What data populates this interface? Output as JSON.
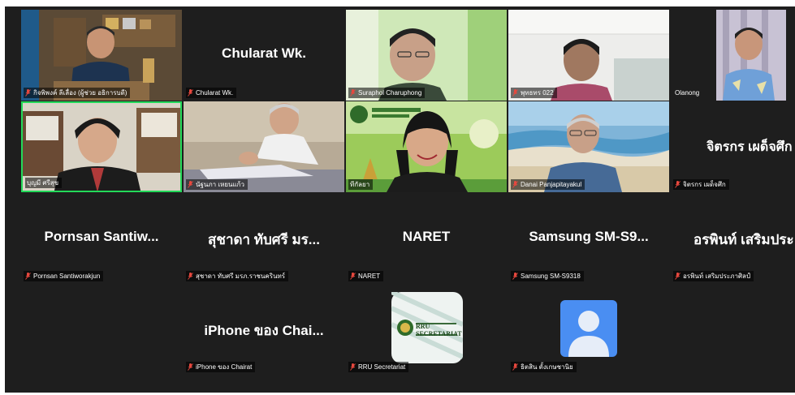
{
  "meeting": {
    "participants": [
      {
        "id": "p1",
        "name": "กิจพิพงค์ ลีเลื่อง (ผู้ช่วย อธิการบดี)",
        "big": "",
        "video": true,
        "muted": true,
        "active": false
      },
      {
        "id": "p2",
        "name": "Chularat Wk.",
        "big": "Chularat Wk.",
        "video": false,
        "muted": true,
        "active": false
      },
      {
        "id": "p3",
        "name": "Suraphol Charuphong",
        "big": "",
        "video": true,
        "muted": true,
        "active": false
      },
      {
        "id": "p4",
        "name": "พุทธทร 022",
        "big": "",
        "video": true,
        "muted": true,
        "active": false
      },
      {
        "id": "p5",
        "name": "Olanong",
        "big": "",
        "video": true,
        "muted": false,
        "active": false
      },
      {
        "id": "p6",
        "name": "บุญมี ศรีสุข",
        "big": "",
        "video": true,
        "muted": false,
        "active": true
      },
      {
        "id": "p7",
        "name": "นัฐนภา เหยนแก้ว",
        "big": "",
        "video": true,
        "muted": true,
        "active": false
      },
      {
        "id": "p8",
        "name": "ทีกัลยา",
        "big": "",
        "video": true,
        "muted": false,
        "active": false
      },
      {
        "id": "p9",
        "name": "Danai Panjapitayakul",
        "big": "",
        "video": true,
        "muted": true,
        "active": false
      },
      {
        "id": "p10",
        "name": "จิตรกร เผด็จศึก",
        "big": "จิตรกร เผด็จศึก",
        "video": false,
        "muted": true,
        "active": false
      },
      {
        "id": "p11",
        "name": "Pornsan Santiworakjun",
        "big": "Pornsan  Santiw...",
        "video": false,
        "muted": true,
        "active": false
      },
      {
        "id": "p12",
        "name": "สุชาดา ทับศรี มรภ.ราชนครินทร์",
        "big": "สุชาดา ทับศรี มร...",
        "video": false,
        "muted": true,
        "active": false
      },
      {
        "id": "p13",
        "name": "NARET",
        "big": "NARET",
        "video": false,
        "muted": true,
        "active": false
      },
      {
        "id": "p14",
        "name": "Samsung SM-S9318",
        "big": "Samsung  SM-S9...",
        "video": false,
        "muted": true,
        "active": false
      },
      {
        "id": "p15",
        "name": "อรพินท์ เสริมประภาศิลป์",
        "big": "อรพินท์ เสริมประ",
        "video": false,
        "muted": true,
        "active": false
      },
      {
        "id": "p16",
        "name": "iPhone ของ Chairat",
        "big": "iPhone ของ Chai...",
        "video": false,
        "muted": true,
        "active": false
      },
      {
        "id": "p17",
        "name": "RRU Secretariat",
        "big": "",
        "video": false,
        "muted": true,
        "active": false,
        "logo": "RRU SECRETARIAT"
      },
      {
        "id": "p18",
        "name": "ธิตสิน ตั้งเกษชานิย",
        "big": "",
        "video": false,
        "muted": true,
        "active": false,
        "avatar": "default-person-avatar"
      }
    ]
  },
  "colors": {
    "background": "#1e1e1e",
    "active_speaker": "#23d959",
    "muted_icon": "#e8483e",
    "avatar_blue": "#4a8ef2"
  }
}
